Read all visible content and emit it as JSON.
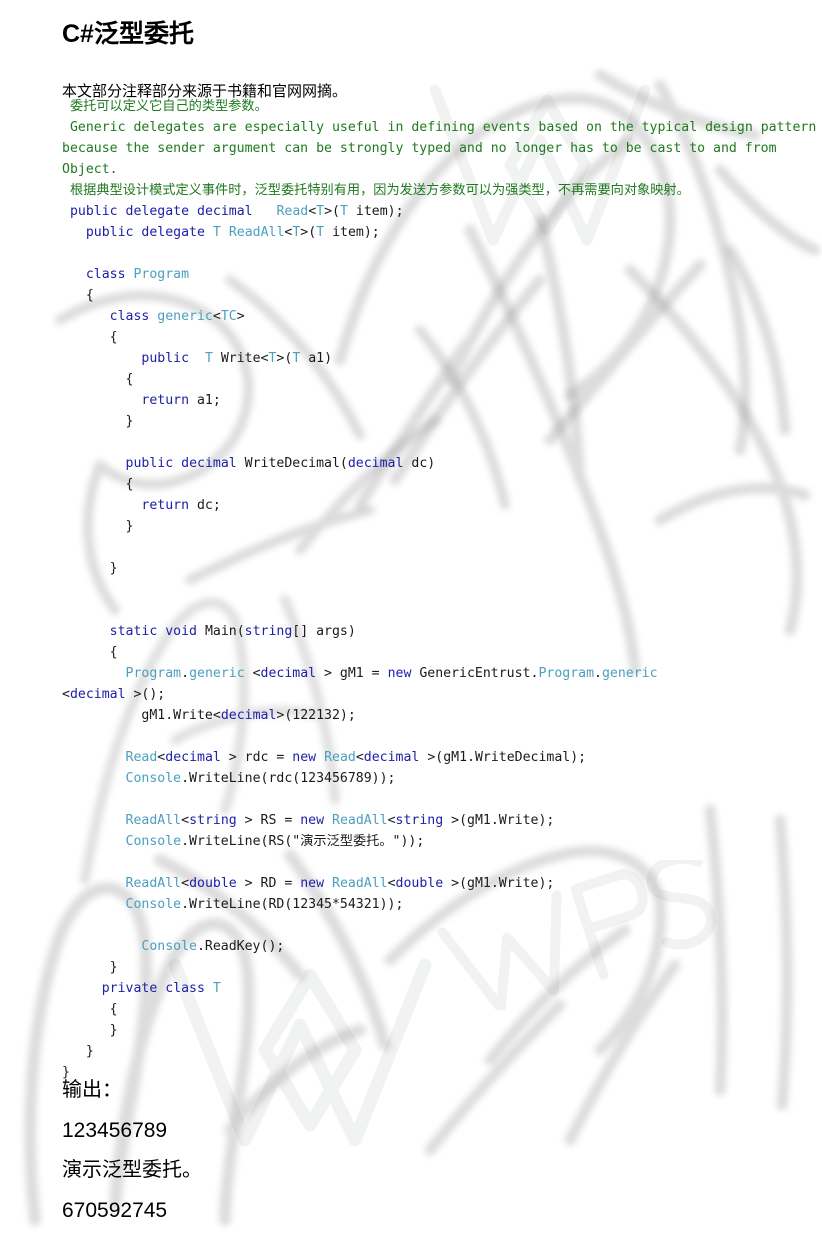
{
  "document": {
    "title": "C#泛型委托",
    "intro": "本文部分注释部分来源于书籍和官网网摘。"
  },
  "code": {
    "lines": [
      {
        "indent": 1,
        "segments": [
          {
            "t": "comment",
            "s": "委托可以定义它自己的类型参数。"
          }
        ]
      },
      {
        "indent": 1,
        "segments": [
          {
            "t": "comment",
            "s": "Generic delegates are especially useful in defining events based on the typical design pattern because the sender argument can be strongly typed and no longer has to be cast to and from Object."
          }
        ]
      },
      {
        "indent": 1,
        "segments": [
          {
            "t": "comment",
            "s": "根据典型设计模式定义事件时，泛型委托特别有用，因为发送方参数可以为强类型，不再需要向对象映射。"
          }
        ]
      },
      {
        "indent": 1,
        "segments": [
          {
            "t": "keyword",
            "s": "public"
          },
          {
            "t": "plain",
            "s": " "
          },
          {
            "t": "keyword",
            "s": "delegate"
          },
          {
            "t": "plain",
            "s": " "
          },
          {
            "t": "keyword",
            "s": "decimal"
          },
          {
            "t": "plain",
            "s": "   "
          },
          {
            "t": "type",
            "s": "Read"
          },
          {
            "t": "plain",
            "s": "<"
          },
          {
            "t": "type",
            "s": "T"
          },
          {
            "t": "plain",
            "s": ">("
          },
          {
            "t": "type",
            "s": "T"
          },
          {
            "t": "plain",
            "s": " item);"
          }
        ]
      },
      {
        "indent": 3,
        "segments": [
          {
            "t": "keyword",
            "s": "public"
          },
          {
            "t": "plain",
            "s": " "
          },
          {
            "t": "keyword",
            "s": "delegate"
          },
          {
            "t": "plain",
            "s": " "
          },
          {
            "t": "type",
            "s": "T"
          },
          {
            "t": "plain",
            "s": " "
          },
          {
            "t": "type",
            "s": "ReadAll"
          },
          {
            "t": "plain",
            "s": "<"
          },
          {
            "t": "type",
            "s": "T"
          },
          {
            "t": "plain",
            "s": ">("
          },
          {
            "t": "type",
            "s": "T"
          },
          {
            "t": "plain",
            "s": " item);"
          }
        ]
      },
      {
        "indent": 0,
        "segments": []
      },
      {
        "indent": 3,
        "segments": [
          {
            "t": "keyword",
            "s": "class"
          },
          {
            "t": "plain",
            "s": " "
          },
          {
            "t": "type",
            "s": "Program"
          }
        ]
      },
      {
        "indent": 3,
        "segments": [
          {
            "t": "plain",
            "s": "{"
          }
        ]
      },
      {
        "indent": 6,
        "segments": [
          {
            "t": "keyword",
            "s": "class"
          },
          {
            "t": "plain",
            "s": " "
          },
          {
            "t": "type",
            "s": "generic"
          },
          {
            "t": "plain",
            "s": "<"
          },
          {
            "t": "type",
            "s": "TC"
          },
          {
            "t": "plain",
            "s": ">"
          }
        ]
      },
      {
        "indent": 6,
        "segments": [
          {
            "t": "plain",
            "s": "{"
          }
        ]
      },
      {
        "indent": 10,
        "segments": [
          {
            "t": "keyword",
            "s": "public"
          },
          {
            "t": "plain",
            "s": "  "
          },
          {
            "t": "type",
            "s": "T"
          },
          {
            "t": "plain",
            "s": " Write<"
          },
          {
            "t": "type",
            "s": "T"
          },
          {
            "t": "plain",
            "s": ">("
          },
          {
            "t": "type",
            "s": "T"
          },
          {
            "t": "plain",
            "s": " a1)"
          }
        ]
      },
      {
        "indent": 8,
        "segments": [
          {
            "t": "plain",
            "s": "{"
          }
        ]
      },
      {
        "indent": 10,
        "segments": [
          {
            "t": "keyword",
            "s": "return"
          },
          {
            "t": "plain",
            "s": " a1;"
          }
        ]
      },
      {
        "indent": 8,
        "segments": [
          {
            "t": "plain",
            "s": "}"
          }
        ]
      },
      {
        "indent": 0,
        "segments": []
      },
      {
        "indent": 8,
        "segments": [
          {
            "t": "keyword",
            "s": "public"
          },
          {
            "t": "plain",
            "s": " "
          },
          {
            "t": "keyword",
            "s": "decimal"
          },
          {
            "t": "plain",
            "s": " WriteDecimal("
          },
          {
            "t": "keyword",
            "s": "decimal"
          },
          {
            "t": "plain",
            "s": " dc)"
          }
        ]
      },
      {
        "indent": 8,
        "segments": [
          {
            "t": "plain",
            "s": "{"
          }
        ]
      },
      {
        "indent": 10,
        "segments": [
          {
            "t": "keyword",
            "s": "return"
          },
          {
            "t": "plain",
            "s": " dc;"
          }
        ]
      },
      {
        "indent": 8,
        "segments": [
          {
            "t": "plain",
            "s": "}"
          }
        ]
      },
      {
        "indent": 0,
        "segments": []
      },
      {
        "indent": 6,
        "segments": [
          {
            "t": "plain",
            "s": "}"
          }
        ]
      },
      {
        "indent": 0,
        "segments": []
      },
      {
        "indent": 0,
        "segments": []
      },
      {
        "indent": 6,
        "segments": [
          {
            "t": "keyword",
            "s": "static"
          },
          {
            "t": "plain",
            "s": " "
          },
          {
            "t": "keyword",
            "s": "void"
          },
          {
            "t": "plain",
            "s": " Main("
          },
          {
            "t": "keyword",
            "s": "string"
          },
          {
            "t": "plain",
            "s": "[] args)"
          }
        ]
      },
      {
        "indent": 6,
        "segments": [
          {
            "t": "plain",
            "s": "{"
          }
        ]
      },
      {
        "indent": 8,
        "segments": [
          {
            "t": "type",
            "s": "Program"
          },
          {
            "t": "plain",
            "s": "."
          },
          {
            "t": "type",
            "s": "generic"
          },
          {
            "t": "plain",
            "s": " <"
          },
          {
            "t": "keyword",
            "s": "decimal"
          },
          {
            "t": "plain",
            "s": " > gM1 = "
          },
          {
            "t": "keyword",
            "s": "new"
          },
          {
            "t": "plain",
            "s": " GenericEntrust."
          },
          {
            "t": "type",
            "s": "Program"
          },
          {
            "t": "plain",
            "s": "."
          },
          {
            "t": "type",
            "s": "generic"
          },
          {
            "t": "plain",
            "s": "\n<"
          },
          {
            "t": "keyword",
            "s": "decimal"
          },
          {
            "t": "plain",
            "s": " >();"
          }
        ]
      },
      {
        "indent": 10,
        "segments": [
          {
            "t": "plain",
            "s": "gM1.Write<"
          },
          {
            "t": "keyword",
            "s": "decimal"
          },
          {
            "t": "plain",
            "s": ">(122132);"
          }
        ]
      },
      {
        "indent": 0,
        "segments": []
      },
      {
        "indent": 8,
        "segments": [
          {
            "t": "type",
            "s": "Read"
          },
          {
            "t": "plain",
            "s": "<"
          },
          {
            "t": "keyword",
            "s": "decimal"
          },
          {
            "t": "plain",
            "s": " > rdc = "
          },
          {
            "t": "keyword",
            "s": "new"
          },
          {
            "t": "plain",
            "s": " "
          },
          {
            "t": "type",
            "s": "Read"
          },
          {
            "t": "plain",
            "s": "<"
          },
          {
            "t": "keyword",
            "s": "decimal"
          },
          {
            "t": "plain",
            "s": " >(gM1.WriteDecimal);"
          }
        ]
      },
      {
        "indent": 8,
        "segments": [
          {
            "t": "type",
            "s": "Console"
          },
          {
            "t": "plain",
            "s": ".WriteLine(rdc(123456789));"
          }
        ]
      },
      {
        "indent": 0,
        "segments": []
      },
      {
        "indent": 8,
        "segments": [
          {
            "t": "type",
            "s": "ReadAll"
          },
          {
            "t": "plain",
            "s": "<"
          },
          {
            "t": "keyword",
            "s": "string"
          },
          {
            "t": "plain",
            "s": " > RS = "
          },
          {
            "t": "keyword",
            "s": "new"
          },
          {
            "t": "plain",
            "s": " "
          },
          {
            "t": "type",
            "s": "ReadAll"
          },
          {
            "t": "plain",
            "s": "<"
          },
          {
            "t": "keyword",
            "s": "string"
          },
          {
            "t": "plain",
            "s": " >(gM1.Write);"
          }
        ]
      },
      {
        "indent": 8,
        "segments": [
          {
            "t": "type",
            "s": "Console"
          },
          {
            "t": "plain",
            "s": ".WriteLine(RS(\"演示泛型委托。\"));"
          }
        ]
      },
      {
        "indent": 0,
        "segments": []
      },
      {
        "indent": 8,
        "segments": [
          {
            "t": "type",
            "s": "ReadAll"
          },
          {
            "t": "plain",
            "s": "<"
          },
          {
            "t": "keyword",
            "s": "double"
          },
          {
            "t": "plain",
            "s": " > RD = "
          },
          {
            "t": "keyword",
            "s": "new"
          },
          {
            "t": "plain",
            "s": " "
          },
          {
            "t": "type",
            "s": "ReadAll"
          },
          {
            "t": "plain",
            "s": "<"
          },
          {
            "t": "keyword",
            "s": "double"
          },
          {
            "t": "plain",
            "s": " >(gM1.Write);"
          }
        ]
      },
      {
        "indent": 8,
        "segments": [
          {
            "t": "type",
            "s": "Console"
          },
          {
            "t": "plain",
            "s": ".WriteLine(RD(12345*54321));"
          }
        ]
      },
      {
        "indent": 0,
        "segments": []
      },
      {
        "indent": 10,
        "segments": [
          {
            "t": "type",
            "s": "Console"
          },
          {
            "t": "plain",
            "s": ".ReadKey();"
          }
        ]
      },
      {
        "indent": 6,
        "segments": [
          {
            "t": "plain",
            "s": "}"
          }
        ]
      },
      {
        "indent": 5,
        "segments": [
          {
            "t": "keyword",
            "s": "private"
          },
          {
            "t": "plain",
            "s": " "
          },
          {
            "t": "keyword",
            "s": "class"
          },
          {
            "t": "plain",
            "s": " "
          },
          {
            "t": "type",
            "s": "T"
          }
        ]
      },
      {
        "indent": 6,
        "segments": [
          {
            "t": "plain",
            "s": "{"
          }
        ]
      },
      {
        "indent": 6,
        "segments": [
          {
            "t": "plain",
            "s": "}"
          }
        ]
      },
      {
        "indent": 3,
        "segments": [
          {
            "t": "plain",
            "s": "}"
          }
        ]
      },
      {
        "indent": 0,
        "segments": [
          {
            "t": "plain",
            "s": "}"
          }
        ]
      }
    ]
  },
  "output": {
    "label": "输出：",
    "lines": [
      "123456789",
      "演示泛型委托。",
      "670592745"
    ]
  },
  "colors": {
    "comment": "#1f7a1f",
    "keyword": "#1f20a8",
    "type": "#4b9fc0",
    "plain": "#1a1a1a",
    "text": "#000000",
    "background": "#ffffff"
  },
  "watermark": {
    "brand": "WPS",
    "note": "blurred handwriting strokes and faint WPS logo"
  }
}
